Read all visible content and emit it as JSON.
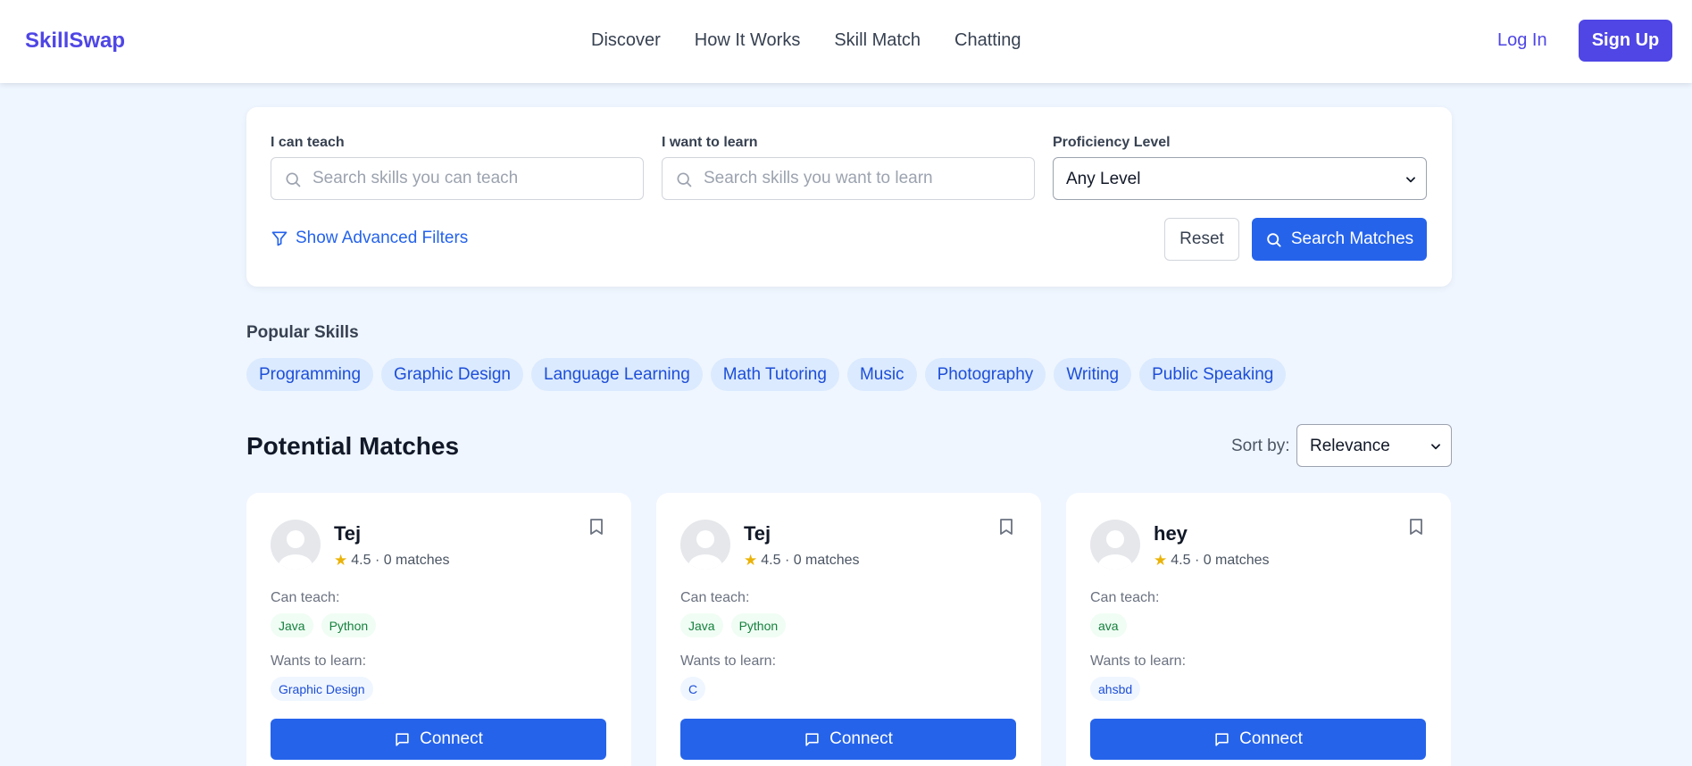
{
  "header": {
    "brand": "SkillSwap",
    "nav": [
      "Discover",
      "How It Works",
      "Skill Match",
      "Chatting"
    ],
    "login_label": "Log In",
    "signup_label": "Sign Up"
  },
  "search": {
    "teach_label": "I can teach",
    "teach_placeholder": "Search skills you can teach",
    "learn_label": "I want to learn",
    "learn_placeholder": "Search skills you want to learn",
    "level_label": "Proficiency Level",
    "level_value": "Any Level",
    "advanced_label": "Show Advanced Filters",
    "reset_label": "Reset",
    "search_label": "Search Matches"
  },
  "popular": {
    "title": "Popular Skills",
    "skills": [
      "Programming",
      "Graphic Design",
      "Language Learning",
      "Math Tutoring",
      "Music",
      "Photography",
      "Writing",
      "Public Speaking"
    ]
  },
  "matches": {
    "title": "Potential Matches",
    "sort_label": "Sort by:",
    "sort_value": "Relevance",
    "teach_label": "Can teach:",
    "learn_label": "Wants to learn:",
    "connect_label": "Connect",
    "cards": [
      {
        "name": "Tej",
        "rating": "4.5 · 0 matches",
        "teach": [
          "Java",
          "Python"
        ],
        "learn": [
          "Graphic Design"
        ]
      },
      {
        "name": "Tej",
        "rating": "4.5 · 0 matches",
        "teach": [
          "Java",
          "Python"
        ],
        "learn": [
          "C"
        ]
      },
      {
        "name": "hey",
        "rating": "4.5 · 0 matches",
        "teach": [
          "ava"
        ],
        "learn": [
          "ahsbd"
        ]
      }
    ]
  },
  "colors": {
    "brand": "#4f46e5",
    "primary": "#2563eb",
    "background": "#eff6ff",
    "star": "#eab308"
  }
}
